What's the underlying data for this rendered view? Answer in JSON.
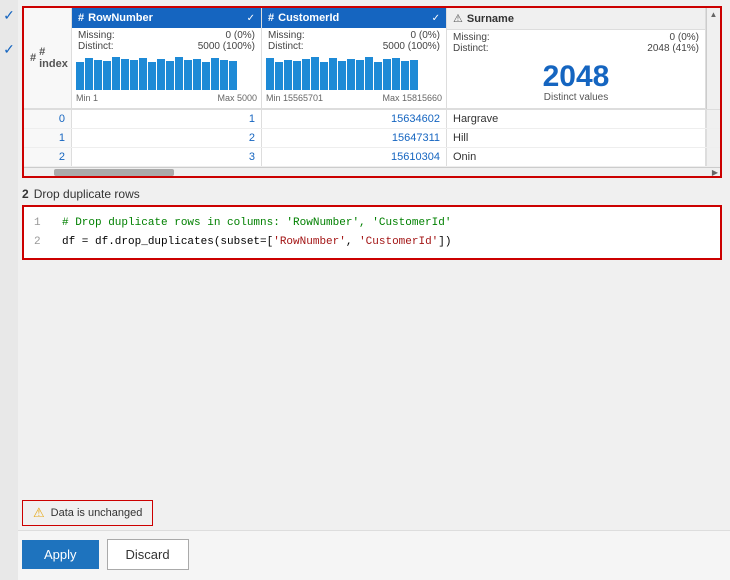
{
  "grid": {
    "columns": {
      "index": {
        "label": "# index"
      },
      "rowNumber": {
        "label": "RowNumber",
        "prefix": "#",
        "missing": "0 (0%)",
        "distinct": "5000 (100%)",
        "min": "Min 1",
        "max": "Max 5000",
        "bars": [
          28,
          32,
          30,
          29,
          33,
          31,
          30,
          32,
          28,
          31,
          29,
          33,
          30,
          31,
          28,
          32,
          29,
          30,
          31
        ]
      },
      "customerId": {
        "label": "CustomerId",
        "prefix": "#",
        "missing": "0 (0%)",
        "distinct": "5000 (100%)",
        "min": "Min 15565701",
        "max": "Max 15815660",
        "bars": [
          32,
          28,
          30,
          29,
          31,
          33,
          30,
          28,
          32,
          29,
          31,
          30,
          33,
          28,
          31,
          32,
          29,
          30,
          28
        ]
      },
      "surname": {
        "label": "Surname",
        "prefix": "a",
        "missing": "0 (0%)",
        "distinct": "2048 (41%)",
        "distinctNumber": "2048",
        "distinctLabel": "Distinct values"
      }
    },
    "rows": [
      {
        "index": "0",
        "rowNumber": "1",
        "customerId": "15634602",
        "surname": "Hargrave"
      },
      {
        "index": "1",
        "rowNumber": "2",
        "customerId": "15647311",
        "surname": "Hill"
      },
      {
        "index": "2",
        "rowNumber": "3",
        "customerId": "15610304",
        "surname": "Onin"
      }
    ]
  },
  "section2": {
    "number": "2",
    "label": "Drop duplicate rows",
    "code": [
      {
        "lineNum": "1",
        "text": "# Drop duplicate rows in columns: 'RowNumber', 'CustomerId'"
      },
      {
        "lineNum": "2",
        "text": "df = df.drop_duplicates(subset=['RowNumber', 'CustomerId'])"
      }
    ]
  },
  "status": {
    "text": "Data is unchanged"
  },
  "buttons": {
    "apply": "Apply",
    "discard": "Discard"
  }
}
